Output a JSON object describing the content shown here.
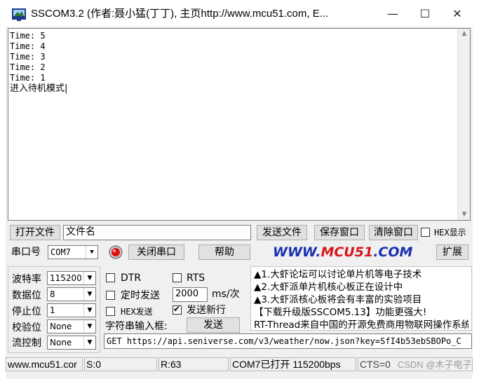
{
  "window": {
    "title": "SSCOM3.2 (作者:聂小猛(丁丁), 主页http://www.mcu51.com,  E...",
    "controls": {
      "minimize": "—",
      "maximize": "☐",
      "close": "✕"
    }
  },
  "receive": {
    "lines": [
      "Time: 5",
      "Time: 4",
      "Time: 3",
      "Time: 2",
      "Time: 1",
      "进入待机模式|"
    ]
  },
  "file_row": {
    "open_file": "打开文件",
    "filename": "文件名",
    "send_file": "发送文件",
    "save_window": "保存窗口",
    "clear_window": "清除窗口",
    "hex_display": "HEX显示"
  },
  "port_row": {
    "port_label": "串口号",
    "port_value": "COM7",
    "close_port": "关闭串口",
    "help": "帮助",
    "banner_left": "WWW.",
    "banner_mid": "MCU51",
    "banner_right": ".COM",
    "expand": "扩展"
  },
  "settings": {
    "baud_label": "波特率",
    "baud_value": "115200",
    "data_label": "数据位",
    "data_value": "8",
    "stop_label": "停止位",
    "stop_value": "1",
    "parity_label": "校验位",
    "parity_value": "None",
    "flow_label": "流控制",
    "flow_value": "None"
  },
  "options": {
    "dtr": "DTR",
    "rts": "RTS",
    "timed_send": "定时发送",
    "interval": "2000",
    "interval_unit": "ms/次",
    "hex_send": "HEX发送",
    "send_newline": "发送新行",
    "input_label": "字符串输入框:",
    "send": "发送",
    "input_value": "GET https://api.seniverse.com/v3/weather/now.json?key=SfI4b53ebSBOPo_C"
  },
  "news": {
    "lines": [
      "▲1.大虾论坛可以讨论单片机等电子技术",
      "▲2.大虾派单片机核心板正在设计中",
      "▲3.大虾派核心板将会有丰富的实验项目",
      "【下载升级版SSCOM5.13】功能更强大!",
      "RT-Thread来自中国的开源免费商用物联网操作系统"
    ]
  },
  "status": {
    "site": "www.mcu51.cor",
    "sent": "S:0",
    "received": "R:63",
    "port_state": "COM7已打开  115200bps",
    "cts": "CTS=0",
    "watermark": "CSDN @木子电子"
  },
  "colors": {
    "banner_blue": "#1a2fb0",
    "banner_red": "#d8141c",
    "status_bg": "#f0f0f0"
  }
}
